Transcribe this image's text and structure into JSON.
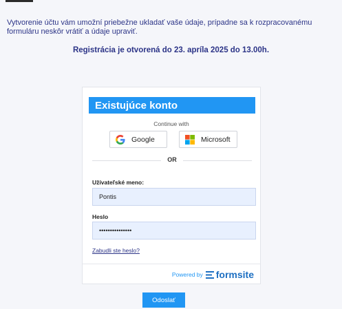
{
  "intro_text": "Vytvorenie účtu vám umožní priebežne ukladať vaše údaje, prípadne sa k rozpracovanému formuláru neskôr vrátiť a údaje upraviť.",
  "notice_text": "Registrácia je otvorená do 23. apríla 2025 do 13.00h.",
  "card": {
    "title": "Existujúce konto",
    "continue_with": "Continue with",
    "google_label": "Google",
    "microsoft_label": "Microsoft",
    "or_label": "OR",
    "username_label": "Užívateľské meno:",
    "username_value": "Pontis",
    "password_label": "Heslo",
    "password_value": "•••••••••••••••",
    "forgot_link": "Zabudli ste heslo?",
    "powered_by": "Powered by",
    "powered_brand": "formsite"
  },
  "submit_label": "Odoslať",
  "colors": {
    "accent": "#2196f3",
    "text_navy": "#2c3487",
    "input_fill": "#e8f0fe"
  },
  "icons": {
    "google": "google-icon",
    "microsoft": "microsoft-icon",
    "formsite": "formsite-logo-icon"
  }
}
